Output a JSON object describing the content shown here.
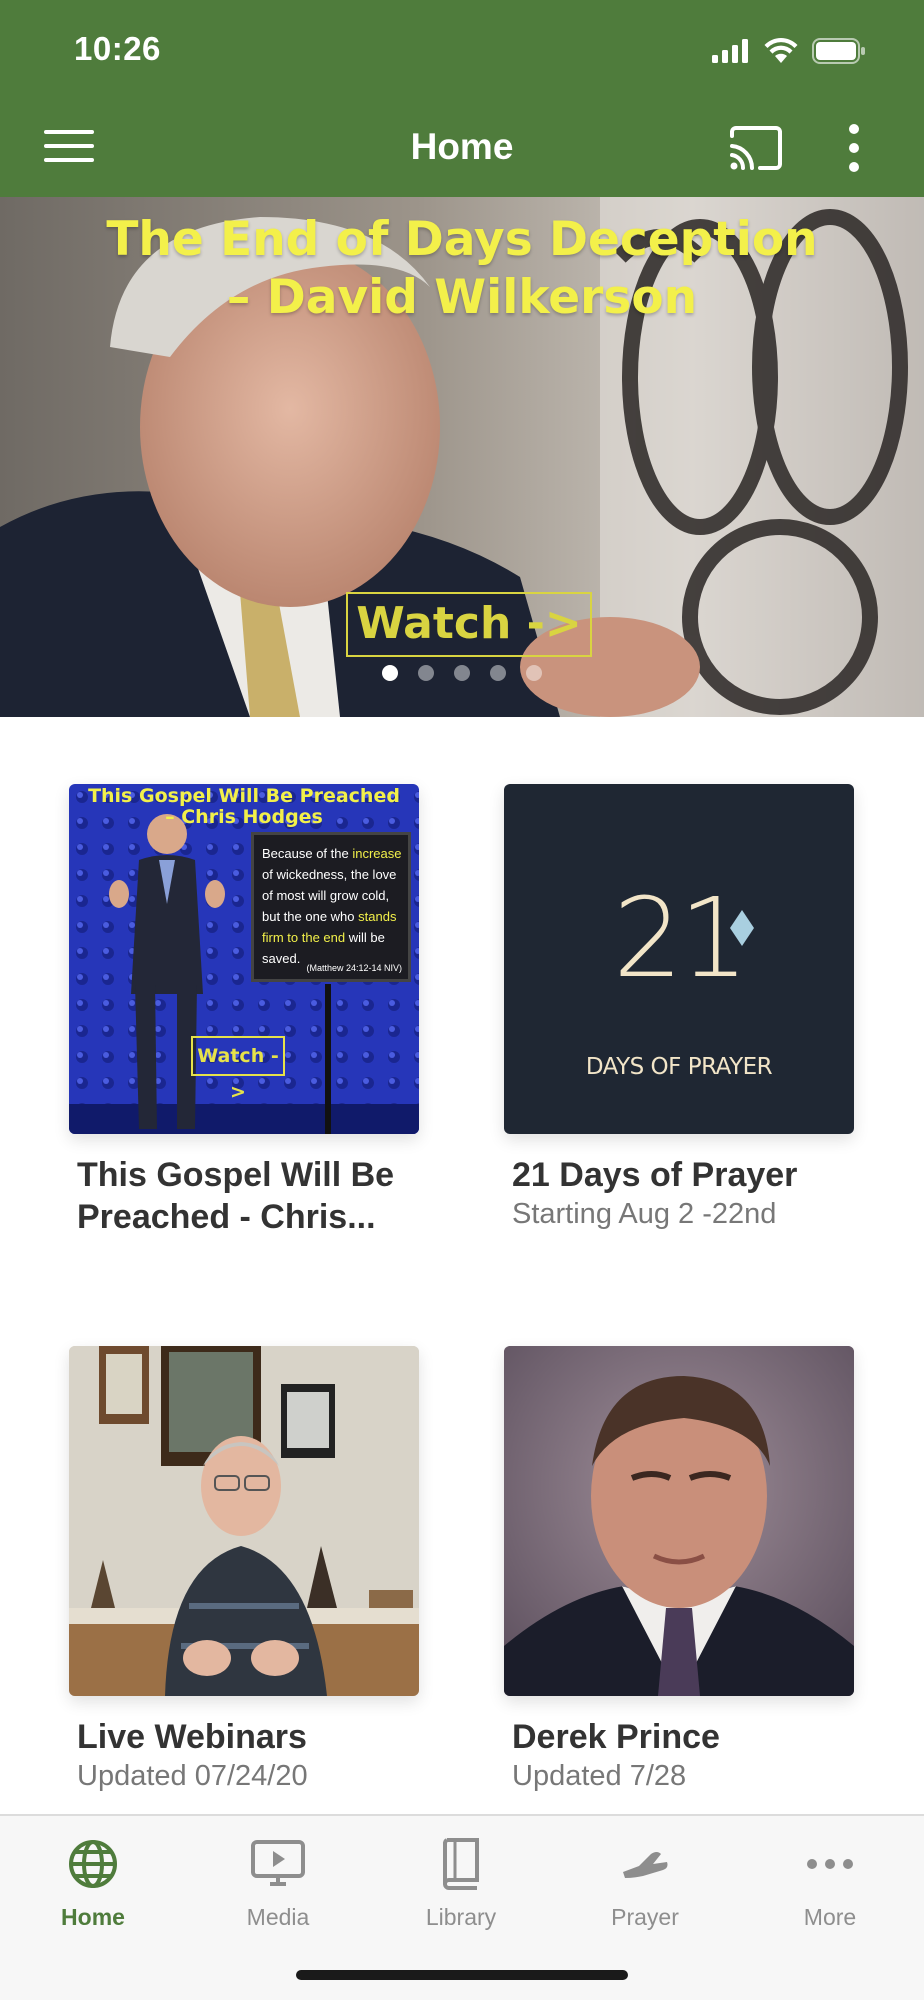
{
  "status_bar": {
    "time": "10:26"
  },
  "app_bar": {
    "title": "Home"
  },
  "hero": {
    "title_line1": "The End of Days Deception",
    "title_line2": "– David Wilkerson",
    "watch_label": "Watch ->",
    "dot_count": 5,
    "active_dot": 0
  },
  "cards": [
    {
      "title": "This Gospel Will Be Preached - Chris...",
      "subtitle": "",
      "thumb": {
        "heading_line1": "This Gospel Will Be Preached",
        "heading_line2": "– Chris Hodges",
        "board_text_1": "Because of the ",
        "board_highlight_1": "increase",
        "board_text_2": " of wickedness, the love of most will grow cold, but the one who ",
        "board_highlight_2": "stands firm to the end",
        "board_text_3": " will be saved.",
        "board_ref": "(Matthew 24:12-14 NIV)",
        "watch_label": "Watch ->"
      }
    },
    {
      "title": "21 Days of Prayer",
      "subtitle": "Starting Aug 2 -22nd",
      "thumb": {
        "number": "21",
        "label": "DAYS OF PRAYER"
      }
    },
    {
      "title": "Live Webinars",
      "subtitle": "Updated 07/24/20"
    },
    {
      "title": "Derek Prince",
      "subtitle": "Updated 7/28"
    }
  ],
  "tabs": [
    {
      "label": "Home",
      "icon": "globe-icon",
      "active": true
    },
    {
      "label": "Media",
      "icon": "tv-play-icon",
      "active": false
    },
    {
      "label": "Library",
      "icon": "book-icon",
      "active": false
    },
    {
      "label": "Prayer",
      "icon": "praying-hands-icon",
      "active": false
    },
    {
      "label": "More",
      "icon": "more-horizontal-icon",
      "active": false
    }
  ],
  "colors": {
    "header_green": "#4f7c3c",
    "accent_yellow": "#f3f04a",
    "tab_inactive": "#8e8e8e",
    "prayer_bg": "#1f2733"
  }
}
